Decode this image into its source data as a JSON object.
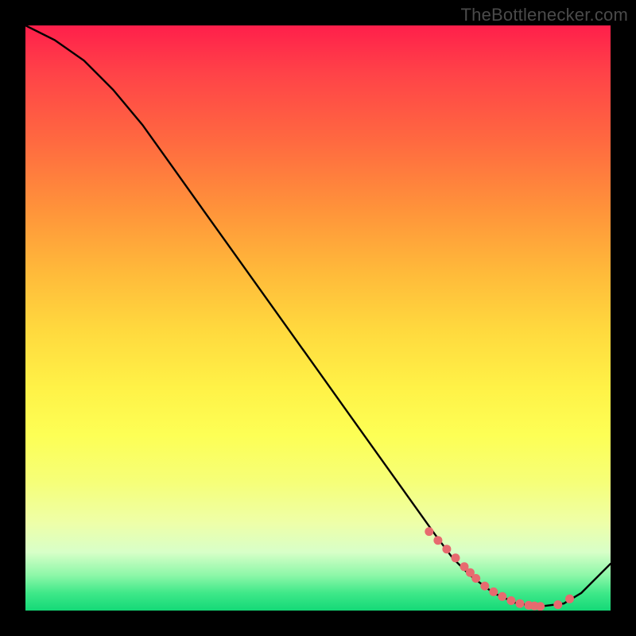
{
  "watermark": "TheBottlenecker.com",
  "chart_data": {
    "type": "line",
    "title": "",
    "xlabel": "",
    "ylabel": "",
    "xlim": [
      0,
      100
    ],
    "ylim": [
      0,
      100
    ],
    "series": [
      {
        "name": "curve",
        "x": [
          0,
          5,
          10,
          15,
          20,
          25,
          30,
          35,
          40,
          45,
          50,
          55,
          60,
          65,
          70,
          73,
          76,
          80,
          84,
          88,
          92,
          95,
          100
        ],
        "y": [
          100,
          97.5,
          94,
          89,
          83,
          76,
          69,
          62,
          55,
          48,
          41,
          34,
          27,
          20,
          13,
          9,
          6,
          3,
          1.2,
          0.7,
          1.2,
          3,
          8
        ]
      }
    ],
    "markers": {
      "name": "highlight-dots",
      "color": "#e76a6f",
      "x": [
        69,
        70.5,
        72,
        73.5,
        75,
        76,
        77,
        78.5,
        80,
        81.5,
        83,
        84.5,
        86,
        87,
        88,
        91,
        93
      ],
      "y": [
        13.5,
        12,
        10.5,
        9,
        7.5,
        6.5,
        5.5,
        4.2,
        3.2,
        2.4,
        1.7,
        1.2,
        0.9,
        0.8,
        0.7,
        1.0,
        2.0
      ]
    }
  }
}
